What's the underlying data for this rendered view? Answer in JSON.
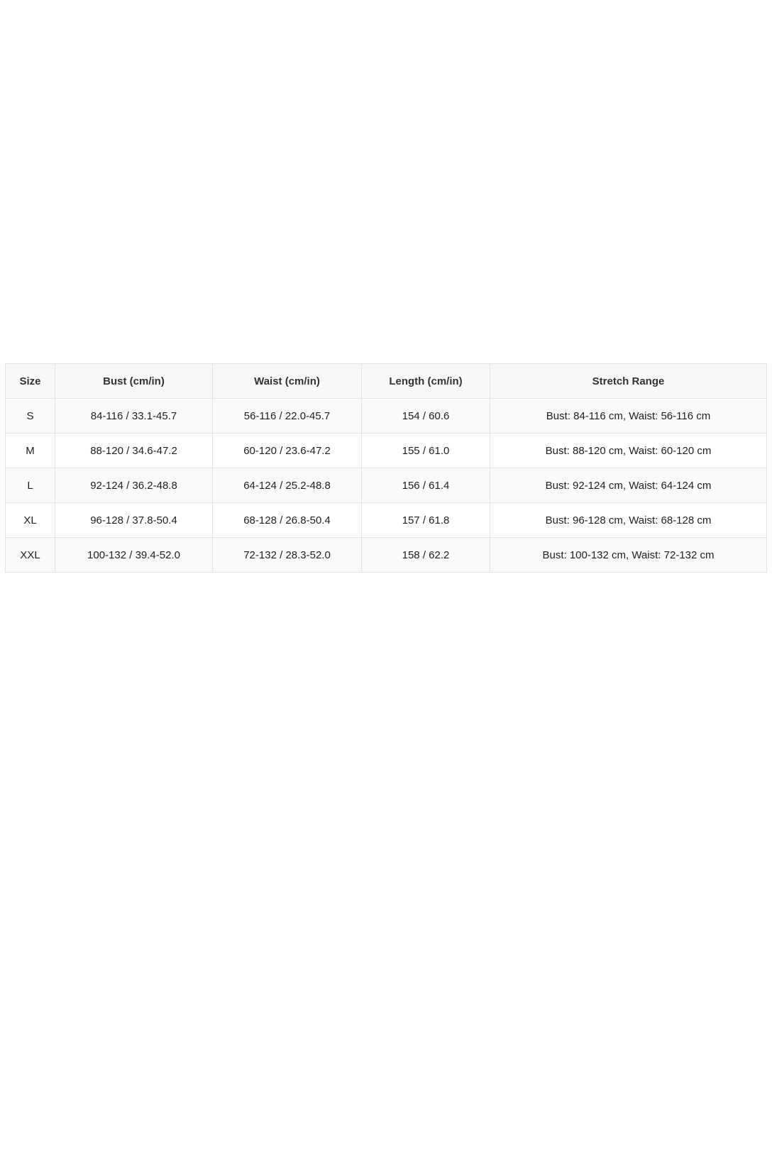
{
  "size_chart": {
    "headers": [
      "Size",
      "Bust (cm/in)",
      "Waist (cm/in)",
      "Length (cm/in)",
      "Stretch Range"
    ],
    "rows": [
      [
        "S",
        "84-116 / 33.1-45.7",
        "56-116 / 22.0-45.7",
        "154 / 60.6",
        "Bust: 84-116 cm, Waist: 56-116 cm"
      ],
      [
        "M",
        "88-120 / 34.6-47.2",
        "60-120 / 23.6-47.2",
        "155 / 61.0",
        "Bust: 88-120 cm, Waist: 60-120 cm"
      ],
      [
        "L",
        "92-124 / 36.2-48.8",
        "64-124 / 25.2-48.8",
        "156 / 61.4",
        "Bust: 92-124 cm, Waist: 64-124 cm"
      ],
      [
        "XL",
        "96-128 / 37.8-50.4",
        "68-128 / 26.8-50.4",
        "157 / 61.8",
        "Bust: 96-128 cm, Waist: 68-128 cm"
      ],
      [
        "XXL",
        "100-132 / 39.4-52.0",
        "72-132 / 28.3-52.0",
        "158 / 62.2",
        "Bust: 100-132 cm, Waist: 72-132 cm"
      ]
    ]
  }
}
